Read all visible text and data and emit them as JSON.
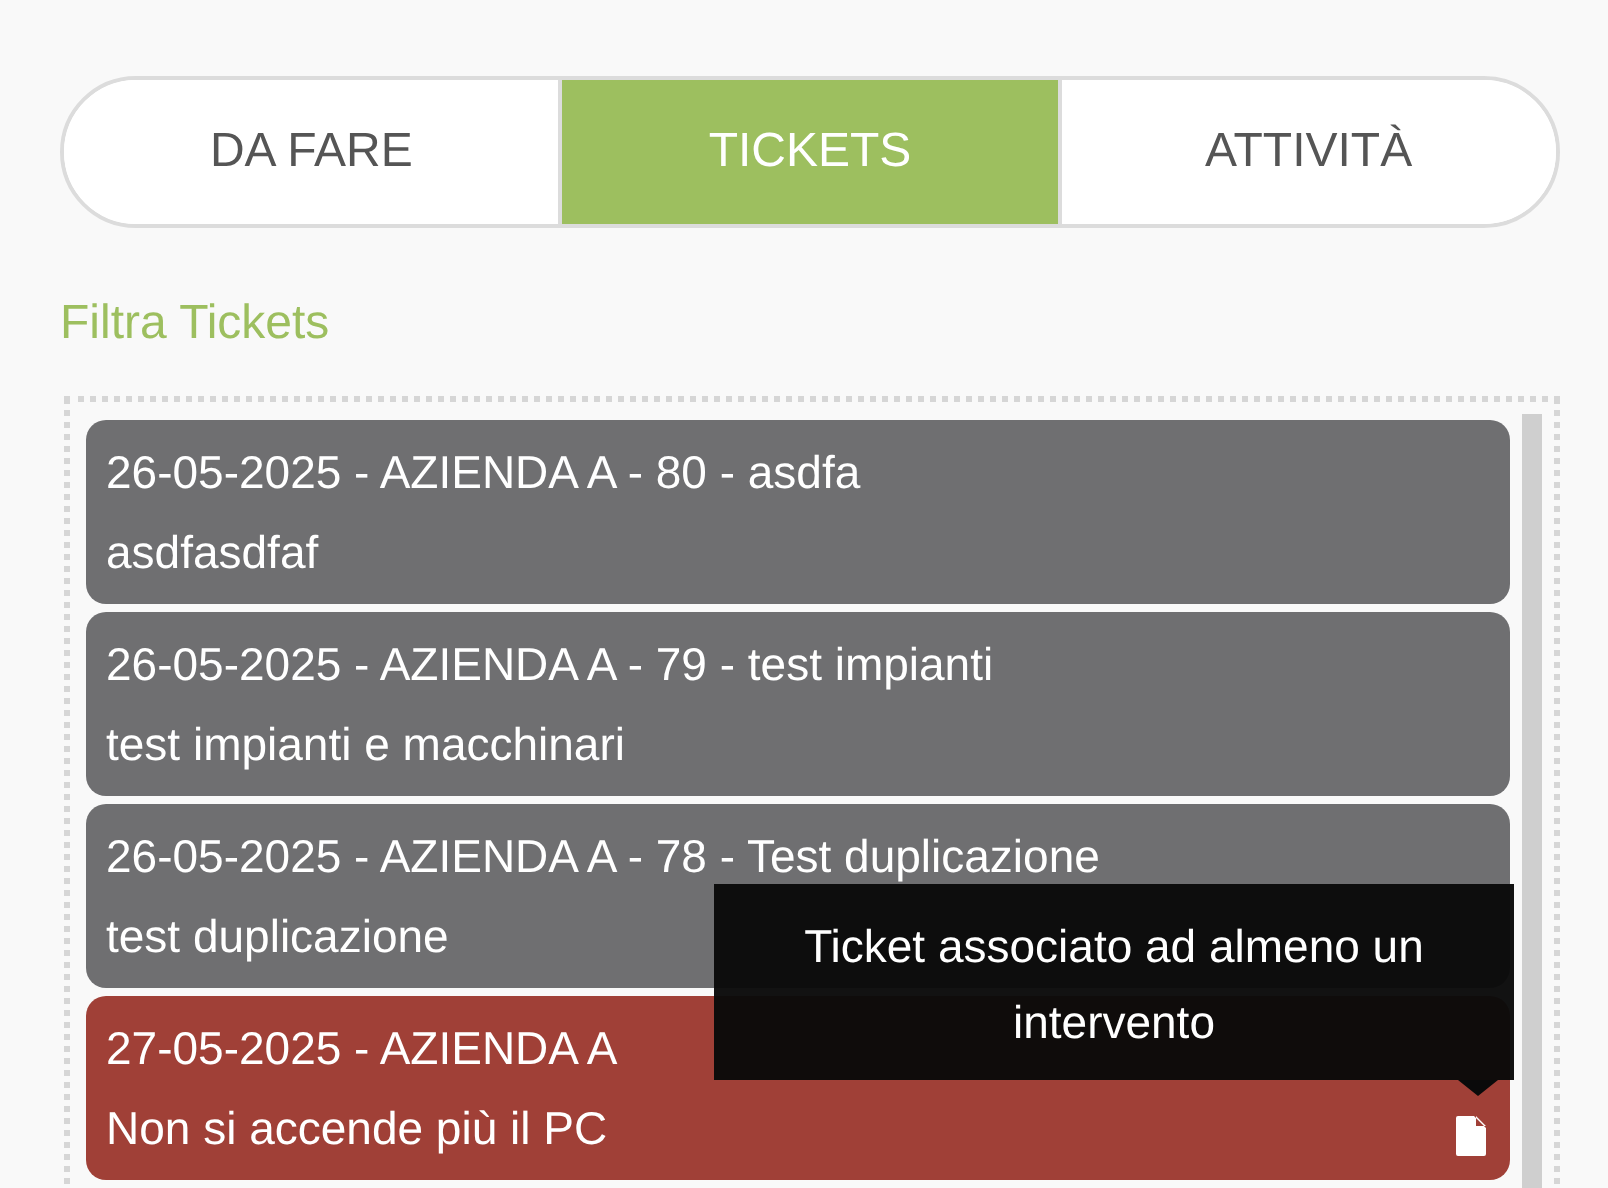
{
  "tabs": [
    {
      "label": "DA FARE",
      "selected": false
    },
    {
      "label": "TICKETS",
      "selected": true
    },
    {
      "label": "ATTIVITÀ",
      "selected": false
    }
  ],
  "filter_label": "Filtra Tickets",
  "tickets": [
    {
      "kind": "normal",
      "title": "26-05-2025 - AZIENDA A - 80 - asdfa",
      "description": "asdfasdfaf"
    },
    {
      "kind": "normal",
      "title": "26-05-2025 - AZIENDA A - 79 - test impianti",
      "description": "test impianti e macchinari"
    },
    {
      "kind": "normal",
      "title": "26-05-2025 - AZIENDA A - 78 - Test duplicazione",
      "description": "test duplicazione"
    },
    {
      "kind": "linked",
      "title": "27-05-2025 - AZIENDA A",
      "description": "Non si accende più il PC",
      "tooltip": "Ticket associato ad almeno un intervento"
    }
  ]
}
